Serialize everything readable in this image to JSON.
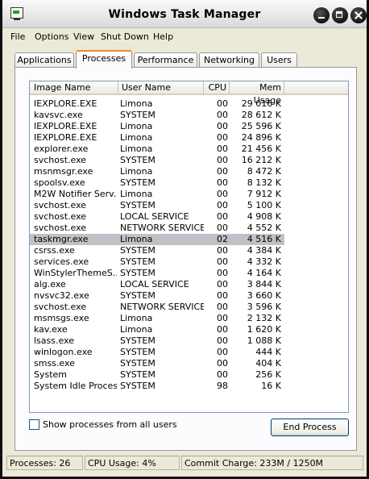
{
  "window": {
    "title": "Windows Task Manager"
  },
  "menu": [
    "File",
    "Options",
    "View",
    "Shut Down",
    "Help"
  ],
  "tabs": [
    "Applications",
    "Processes",
    "Performance",
    "Networking",
    "Users"
  ],
  "active_tab": "Processes",
  "columns": {
    "name": "Image Name",
    "user": "User Name",
    "cpu": "CPU",
    "mem": "Mem Usage"
  },
  "processes": [
    {
      "name": "IEXPLORE.EXE",
      "user": "Limona",
      "cpu": "00",
      "mem": "29 016 K"
    },
    {
      "name": "kavsvc.exe",
      "user": "SYSTEM",
      "cpu": "00",
      "mem": "28 612 K"
    },
    {
      "name": "IEXPLORE.EXE",
      "user": "Limona",
      "cpu": "00",
      "mem": "25 596 K"
    },
    {
      "name": "IEXPLORE.EXE",
      "user": "Limona",
      "cpu": "00",
      "mem": "24 896 K"
    },
    {
      "name": "explorer.exe",
      "user": "Limona",
      "cpu": "00",
      "mem": "21 456 K"
    },
    {
      "name": "svchost.exe",
      "user": "SYSTEM",
      "cpu": "00",
      "mem": "16 212 K"
    },
    {
      "name": "msnmsgr.exe",
      "user": "Limona",
      "cpu": "00",
      "mem": "8 472 K"
    },
    {
      "name": "spoolsv.exe",
      "user": "SYSTEM",
      "cpu": "00",
      "mem": "8 132 K"
    },
    {
      "name": "M2W Notifier Serv...",
      "user": "Limona",
      "cpu": "00",
      "mem": "7 912 K"
    },
    {
      "name": "svchost.exe",
      "user": "SYSTEM",
      "cpu": "00",
      "mem": "5 100 K"
    },
    {
      "name": "svchost.exe",
      "user": "LOCAL SERVICE",
      "cpu": "00",
      "mem": "4 908 K"
    },
    {
      "name": "svchost.exe",
      "user": "NETWORK SERVICE",
      "cpu": "00",
      "mem": "4 552 K"
    },
    {
      "name": "taskmgr.exe",
      "user": "Limona",
      "cpu": "02",
      "mem": "4 516 K",
      "selected": true
    },
    {
      "name": "csrss.exe",
      "user": "SYSTEM",
      "cpu": "00",
      "mem": "4 384 K"
    },
    {
      "name": "services.exe",
      "user": "SYSTEM",
      "cpu": "00",
      "mem": "4 332 K"
    },
    {
      "name": "WinStylerThemeS...",
      "user": "SYSTEM",
      "cpu": "00",
      "mem": "4 164 K"
    },
    {
      "name": "alg.exe",
      "user": "LOCAL SERVICE",
      "cpu": "00",
      "mem": "3 844 K"
    },
    {
      "name": "nvsvc32.exe",
      "user": "SYSTEM",
      "cpu": "00",
      "mem": "3 660 K"
    },
    {
      "name": "svchost.exe",
      "user": "NETWORK SERVICE",
      "cpu": "00",
      "mem": "3 596 K"
    },
    {
      "name": "msmsgs.exe",
      "user": "Limona",
      "cpu": "00",
      "mem": "2 132 K"
    },
    {
      "name": "kav.exe",
      "user": "Limona",
      "cpu": "00",
      "mem": "1 620 K"
    },
    {
      "name": "lsass.exe",
      "user": "SYSTEM",
      "cpu": "00",
      "mem": "1 088 K"
    },
    {
      "name": "winlogon.exe",
      "user": "SYSTEM",
      "cpu": "00",
      "mem": "444 K"
    },
    {
      "name": "smss.exe",
      "user": "SYSTEM",
      "cpu": "00",
      "mem": "404 K"
    },
    {
      "name": "System",
      "user": "SYSTEM",
      "cpu": "00",
      "mem": "256 K"
    },
    {
      "name": "System Idle Process",
      "user": "SYSTEM",
      "cpu": "98",
      "mem": "16 K"
    }
  ],
  "show_all_users": {
    "label": "Show processes from all users",
    "checked": false
  },
  "end_process_label": "End Process",
  "status": {
    "processes": "Processes: 26",
    "cpu": "CPU Usage: 4%",
    "commit": "Commit Charge: 233M / 1250M"
  },
  "colors": {
    "selection": "#c0c0c7",
    "tab_highlight": "#e68b2c",
    "desktop": "#d20a1c"
  }
}
